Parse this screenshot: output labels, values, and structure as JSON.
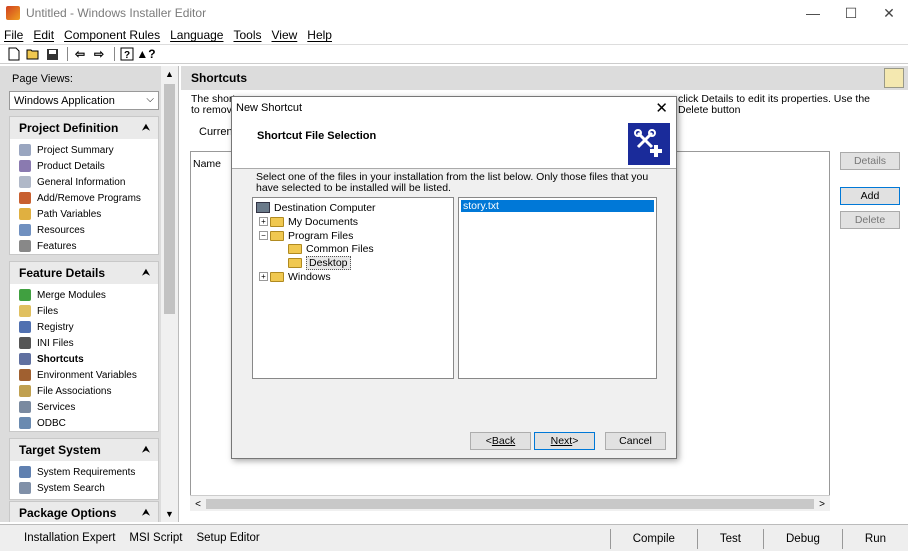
{
  "window": {
    "title": "Untitled - Windows Installer Editor",
    "minimize": "—",
    "maximize": "☐",
    "close": "✕"
  },
  "menu": [
    "File",
    "Edit",
    "Component Rules",
    "Language",
    "Tools",
    "View",
    "Help"
  ],
  "toolbar": {
    "icons": [
      "new-file-icon",
      "open-folder-icon",
      "save-icon",
      "back-arrow-icon",
      "forward-arrow-icon",
      "help-icon",
      "whats-this-help-icon"
    ]
  },
  "left": {
    "page_views_label": "Page Views:",
    "page_views_value": "Windows Application",
    "groups": [
      {
        "title": "Project Definition",
        "items": [
          "Project Summary",
          "Product Details",
          "General Information",
          "Add/Remove Programs",
          "Path Variables",
          "Resources",
          "Features"
        ]
      },
      {
        "title": "Feature Details",
        "items": [
          "Merge Modules",
          "Files",
          "Registry",
          "INI Files",
          "Shortcuts",
          "Environment Variables",
          "File Associations",
          "Services",
          "ODBC"
        ],
        "selected": "Shortcuts"
      },
      {
        "title": "Target System",
        "items": [
          "System Requirements",
          "System Search"
        ]
      },
      {
        "title": "Package Options",
        "items": []
      }
    ]
  },
  "main": {
    "title": "Shortcuts",
    "description_left": "The shortc",
    "description_left2": "to remove",
    "description_right": "click Details to edit its properties. Use the Delete button",
    "current_label": "Current",
    "column_name": "Name",
    "buttons": {
      "details": "Details",
      "add": "Add",
      "delete": "Delete"
    }
  },
  "statusbar": {
    "left": [
      "Installation Expert",
      "MSI Script",
      "Setup Editor"
    ],
    "right": [
      "Compile",
      "Test",
      "Debug",
      "Run"
    ]
  },
  "dialog": {
    "title": "New Shortcut",
    "banner_title": "Shortcut File Selection",
    "instructions": "Select one of the files in your installation from the list below. Only those files that you have selected to be installed will be listed.",
    "tree": {
      "root": "Destination Computer",
      "nodes": [
        "My Documents",
        "Program Files",
        "Common Files",
        "Desktop",
        "Windows"
      ]
    },
    "files": [
      "story.txt"
    ],
    "buttons": {
      "back": "Back",
      "back_prefix": "< ",
      "next": "Next",
      "next_suffix": " >",
      "cancel": "Cancel"
    }
  },
  "colors": {
    "selection": "#0078d7",
    "banner_icon": "#1a2b9a",
    "pane_bg": "#dcdcdc"
  }
}
